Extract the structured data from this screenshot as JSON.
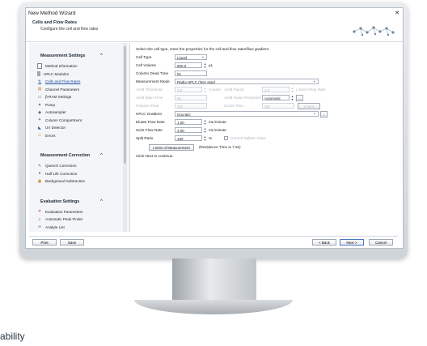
{
  "window": {
    "title": "New Method Wizard",
    "close_icon": "close-icon"
  },
  "header": {
    "title": "Cells and Flow Rates",
    "subtitle": "Configure the cell and flow rates"
  },
  "sidebar": {
    "sections": [
      {
        "title": "Measurement Settings",
        "items": [
          {
            "label": "Method Information",
            "icon": "document-icon"
          },
          {
            "label": "HPLC Modules",
            "icon": "module-icon"
          },
          {
            "label": "Cells and Flow Rates",
            "icon": "flow-cell-icon",
            "active": true
          },
          {
            "label": "Channel Parameters",
            "icon": "channel-icon"
          },
          {
            "label": "β-RAM Settings",
            "icon": "detector-icon"
          },
          {
            "label": "Pump",
            "icon": "pump-icon"
          },
          {
            "label": "Autosampler",
            "icon": "autosampler-icon"
          },
          {
            "label": "Column Compartment",
            "icon": "column-icon"
          },
          {
            "label": "UV Detector",
            "icon": "uv-icon"
          },
          {
            "label": "Errors",
            "icon": "warning-icon"
          }
        ]
      },
      {
        "title": "Measurement Correction",
        "items": [
          {
            "label": "Quench Correction",
            "icon": "quench-icon"
          },
          {
            "label": "Half Life Correction",
            "icon": "half-life-icon"
          },
          {
            "label": "Background Subtraction",
            "icon": "background-icon"
          }
        ]
      },
      {
        "title": "Evaluation Settings",
        "items": [
          {
            "label": "Evaluation Parameters",
            "icon": "parameters-icon"
          },
          {
            "label": "Automatic Peak Finder",
            "icon": "peak-finder-icon"
          },
          {
            "label": "Analyte List",
            "icon": "analyte-icon"
          }
        ]
      }
    ],
    "collapse_symbol": "^"
  },
  "main": {
    "intro": "Select the cell type, enter the properties for the cell and flow rates/flow gradient.",
    "cell_type": {
      "label": "Cell Type",
      "value": "Liquid"
    },
    "cell_volume": {
      "label": "Cell Volume",
      "value": "500.0",
      "unit": "µL"
    },
    "column_dead_time": {
      "label": "Column Dead Time",
      "value": "0s"
    },
    "measurement_mode": {
      "label": "Measurement Mode",
      "value": "Radio HPLC (Non stop)"
    },
    "acm_threshold": {
      "label": "ACM Threshold",
      "value": "2.5",
      "unit": "Counts"
    },
    "acm_factor": {
      "label": "ACM Factor",
      "value": "2.0",
      "unit": "x Scint Flow Rate"
    },
    "acm_main_time": {
      "label": "ACM Main Time",
      "value": "8s"
    },
    "acm_noise_reduction": {
      "label": "ACM Noise Reduction",
      "value": "Automatic"
    },
    "fraction_time": {
      "label": "Fraction Time",
      "value": "10s"
    },
    "count_time": {
      "label": "Count Time",
      "value": "30s"
    },
    "count_zones_button": "Count Zones...",
    "hplc_gradient": {
      "label": "HPLC Gradient",
      "value": "Isocratic"
    },
    "eluate_flow_rate": {
      "label": "Eluate Flow Rate",
      "value": "1.00",
      "unit": "mL/minute"
    },
    "scint_flow_rate": {
      "label": "Scint Flow Rate",
      "value": "3.00",
      "unit": "mL/minute"
    },
    "split_ratio": {
      "label": "Split Ratio",
      "value": "100",
      "unit": "%"
    },
    "control_splitter": {
      "label": "Control Splitter Value",
      "checked": false
    },
    "limits_button": "Limits of Measurement",
    "residence_time": "(Residence Time is 7.5s)",
    "hint": "Click Next to continue.",
    "ellipsis": "..."
  },
  "footer": {
    "print": "Print",
    "save": "Save",
    "back": "< Back",
    "next": "Next >",
    "cancel": "Cancel"
  },
  "caption": "ability"
}
